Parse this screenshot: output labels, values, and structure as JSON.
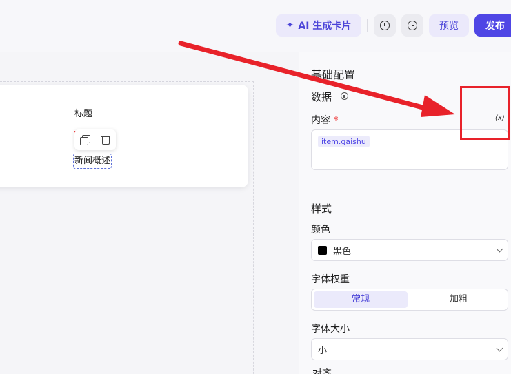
{
  "toolbar": {
    "ai_generate_label": "AI 生成卡片",
    "preview_label": "预览",
    "publish_label": "发布"
  },
  "canvas": {
    "card": {
      "title": "标题",
      "news_summary": "新闻概述"
    }
  },
  "panel": {
    "basic_config_title": "基础配置",
    "data_section_title": "数据",
    "content_label": "内容",
    "required_mark": "*",
    "variable_icon_text": "(x)",
    "content_tag": "item.gaishu",
    "style_section_title": "样式",
    "color_label": "颜色",
    "color_value": "黑色",
    "color_swatch": "#000000",
    "font_weight_label": "字体权重",
    "font_weight_options": [
      "常规",
      "加粗"
    ],
    "font_weight_selected": "常规",
    "font_size_label": "字体大小",
    "font_size_value": "小"
  },
  "annotation": {
    "color": "#e8222a"
  },
  "colors": {
    "accent": "#4f46e5",
    "accent_soft": "#ebe9fb"
  }
}
